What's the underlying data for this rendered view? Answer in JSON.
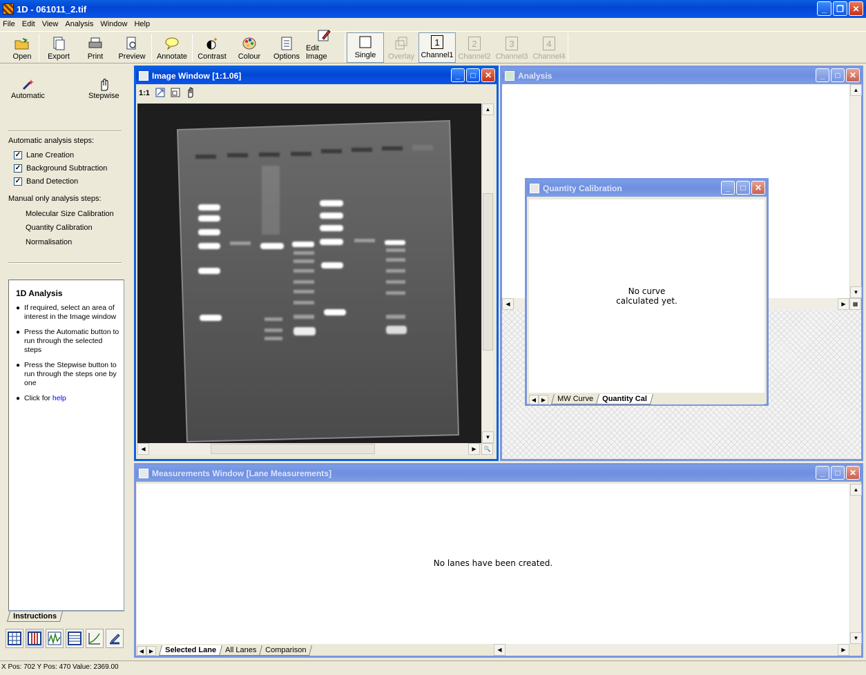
{
  "app": {
    "title": "1D - 061011_2.tif"
  },
  "menu": [
    "File",
    "Edit",
    "View",
    "Analysis",
    "Window",
    "Help"
  ],
  "toolbar": {
    "open": "Open",
    "export": "Export",
    "print": "Print",
    "preview": "Preview",
    "annotate": "Annotate",
    "contrast": "Contrast",
    "colour": "Colour",
    "options": "Options",
    "edit_image": "Edit Image",
    "single": "Single",
    "overlay": "Overlay",
    "channel1": "Channel1",
    "channel2": "Channel2",
    "channel3": "Channel3",
    "channel4": "Channel4",
    "ch1_num": "1",
    "ch2_num": "2",
    "ch3_num": "3",
    "ch4_num": "4"
  },
  "left": {
    "automatic": "Automatic",
    "stepwise": "Stepwise",
    "auto_steps_title": "Automatic analysis steps:",
    "auto_steps": [
      "Lane Creation",
      "Background Subtraction",
      "Band Detection"
    ],
    "manual_steps_title": "Manual only analysis steps:",
    "manual_steps": [
      "Molecular Size Calibration",
      "Quantity Calibration",
      "Normalisation"
    ],
    "instructions_title": "1D Analysis",
    "instructions": [
      "If required, select an area of interest in the Image window",
      "Press the Automatic button to run through the selected steps",
      "Press the Stepwise button to run through the steps one by one"
    ],
    "click_for": "Click for",
    "help_link": "help",
    "instructions_tab": "Instructions"
  },
  "image_window": {
    "title": "Image Window [1:1.06]",
    "zoom_label": "1:1"
  },
  "analysis_window": {
    "title": "Analysis"
  },
  "quantity_window": {
    "title": "Quantity Calibration",
    "message_line1": "No curve",
    "message_line2": "calculated yet.",
    "tabs": [
      "MW Curve",
      "Quantity Cal"
    ]
  },
  "measurements_window": {
    "title": "Measurements Window [Lane Measurements]",
    "message": "No lanes have been created.",
    "tabs": [
      "Selected Lane",
      "All Lanes",
      "Comparison"
    ]
  },
  "status": "X Pos: 702 Y Pos: 470 Value: 2369.00",
  "colors": {
    "xp_blue": "#0a5fe0",
    "face": "#ece9d8",
    "gel_bg": "#1e1e1e"
  }
}
